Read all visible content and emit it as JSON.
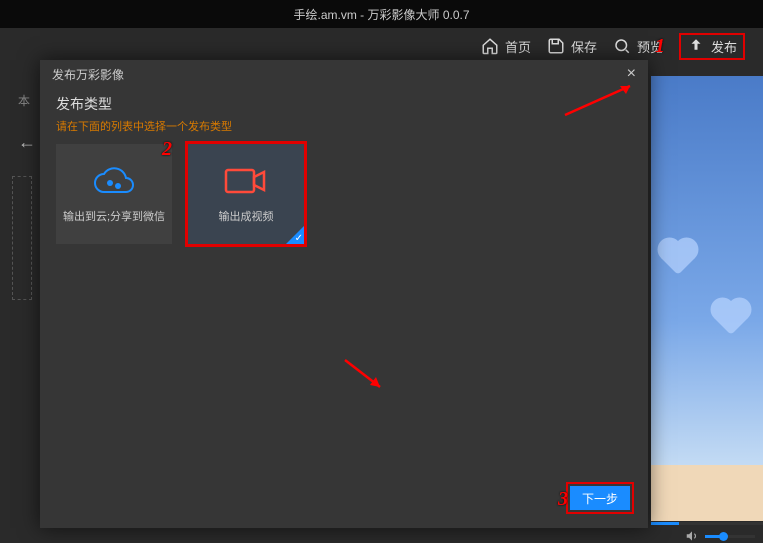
{
  "title": "手绘.am.vm - 万彩影像大师 0.0.7",
  "menu": {
    "home": "首页",
    "save": "保存",
    "preview": "预览",
    "publish": "发布"
  },
  "left_hint": "本",
  "dialog": {
    "header": "发布万彩影像",
    "section_title": "发布类型",
    "section_hint": "请在下面的列表中选择一个发布类型",
    "options": {
      "cloud": "输出到云;分享到微信",
      "video": "输出成视频"
    },
    "next": "下一步"
  },
  "markers": {
    "m1": "1",
    "m2": "2",
    "m3": "3"
  }
}
